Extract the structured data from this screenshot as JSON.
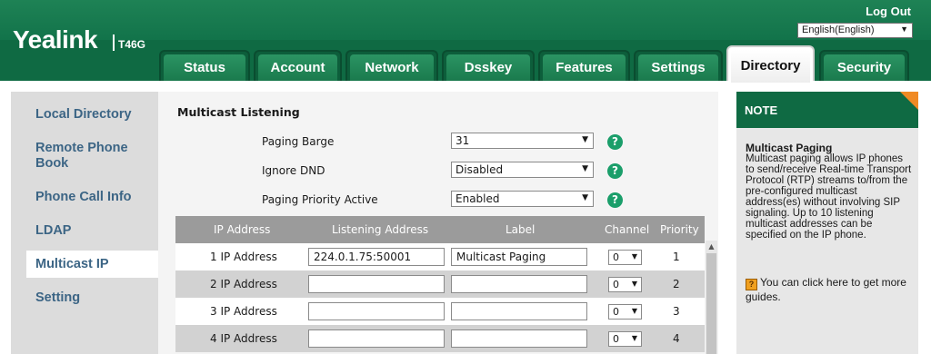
{
  "header": {
    "brand": "Yealink",
    "model": "T46G",
    "logout": "Log Out",
    "language": "English(English)"
  },
  "tabs": [
    {
      "label": "Status",
      "active": false
    },
    {
      "label": "Account",
      "active": false
    },
    {
      "label": "Network",
      "active": false
    },
    {
      "label": "Dsskey",
      "active": false
    },
    {
      "label": "Features",
      "active": false
    },
    {
      "label": "Settings",
      "active": false
    },
    {
      "label": "Directory",
      "active": true
    },
    {
      "label": "Security",
      "active": false
    }
  ],
  "sidebar": {
    "items": [
      {
        "label": "Local Directory"
      },
      {
        "label": "Remote Phone Book"
      },
      {
        "label": "Phone Call Info"
      },
      {
        "label": "LDAP"
      },
      {
        "label": "Multicast IP",
        "active": true
      },
      {
        "label": "Setting"
      }
    ]
  },
  "main": {
    "section_title": "Multicast Listening",
    "fields": [
      {
        "label": "Paging Barge",
        "value": "31"
      },
      {
        "label": "Ignore DND",
        "value": "Disabled"
      },
      {
        "label": "Paging Priority Active",
        "value": "Enabled"
      }
    ],
    "help_glyph": "?",
    "table": {
      "headers": [
        "IP Address",
        "Listening Address",
        "Label",
        "Channel",
        "Priority"
      ],
      "rows": [
        {
          "label": "1 IP Address",
          "address": "224.0.1.75:50001",
          "name": "Multicast Paging",
          "channel": "0",
          "priority": "1"
        },
        {
          "label": "2 IP Address",
          "address": "",
          "name": "",
          "channel": "0",
          "priority": "2"
        },
        {
          "label": "3 IP Address",
          "address": "",
          "name": "",
          "channel": "0",
          "priority": "3"
        },
        {
          "label": "4 IP Address",
          "address": "",
          "name": "",
          "channel": "0",
          "priority": "4"
        }
      ]
    }
  },
  "note": {
    "title": "NOTE",
    "heading": "Multicast Paging",
    "body": "Multicast paging allows IP phones to send/receive Real-time Transport Protocol (RTP) streams to/from the pre-configured multicast address(es) without involving SIP signaling. Up to 10 listening multicast addresses can be specified on the IP phone.",
    "guide": "You can click here to get more guides."
  },
  "colors": {
    "brand_green": "#0f6a43",
    "accent_orange": "#f08a24",
    "sidebar_link": "#3c6585"
  }
}
